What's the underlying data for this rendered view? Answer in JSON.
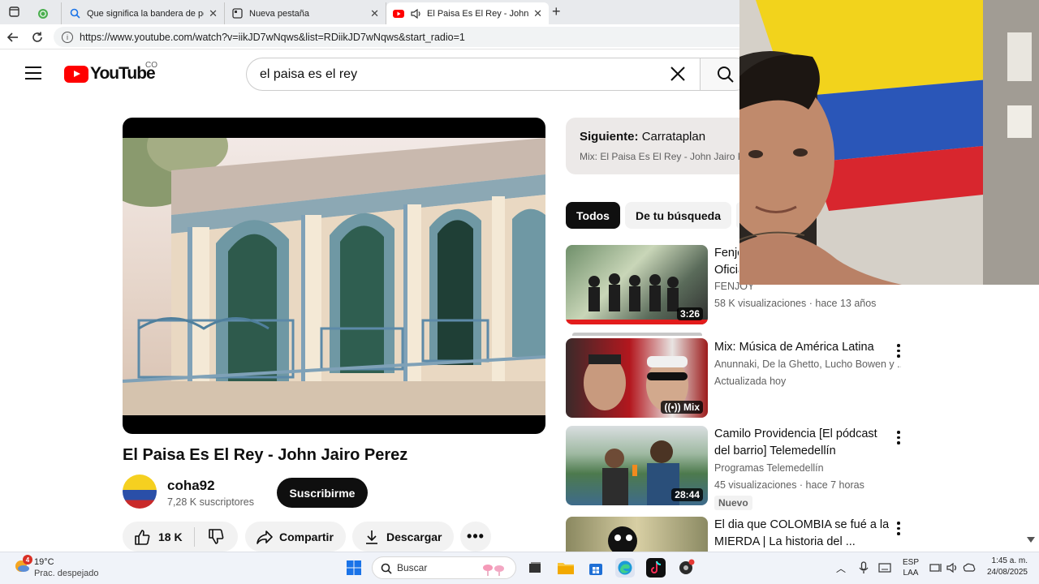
{
  "browser": {
    "tabs": [
      {
        "title": ""
      },
      {
        "title": "Que significa la bandera de pereira"
      },
      {
        "title": "Nueva pestaña"
      },
      {
        "title": "El Paisa Es El Rey - John Jairo Perez"
      }
    ],
    "url": "https://www.youtube.com/watch?v=iikJD7wNqws&list=RDiikJD7wNqws&start_radio=1"
  },
  "youtube": {
    "logo_text": "YouTube",
    "country_code": "CO",
    "search_query": "el paisa es el rey"
  },
  "video": {
    "title": "El Paisa Es El Rey - John Jairo Perez",
    "channel": "coha92",
    "subscribers": "7,28 K suscriptores",
    "subscribe_label": "Suscribirme",
    "likes": "18 K",
    "share_label": "Compartir",
    "download_label": "Descargar"
  },
  "up_next": {
    "prefix": "Siguiente:",
    "title": "Carrataplan",
    "playlist": "Mix: El Paisa Es El Rey - John Jairo Perez"
  },
  "chips": [
    "Todos",
    "De tu búsqueda"
  ],
  "recommendations": [
    {
      "title1": "Fenjoy - El Paisa Es El Rey (Video",
      "title2": "Oficial)",
      "channel": "FENJOY",
      "meta": "58 K visualizaciones · hace 13 años",
      "badge": "3:26"
    },
    {
      "title1": "Mix: Música de América Latina",
      "title2": "",
      "channel": "Anunnaki, De la Ghetto, Lucho Bowen y ...",
      "meta": "Actualizada hoy",
      "badge": "Mix"
    },
    {
      "title1": "Camilo Providencia [El pódcast",
      "title2": "del barrio] Telemedellín",
      "channel": "Programas Telemedellín",
      "meta": "45 visualizaciones · hace 7 horas",
      "badge": "28:44",
      "tag": "Nuevo"
    },
    {
      "title1": "El dia que COLOMBIA se fué a la",
      "title2": "MIERDA | La historia del ...",
      "channel": "",
      "meta": "",
      "badge": ""
    }
  ],
  "taskbar": {
    "weather_temp": "19°C",
    "weather_desc": "Prac. despejado",
    "weather_badge": "4",
    "search_placeholder": "Buscar",
    "lang1": "ESP",
    "lang2": "LAA",
    "time": "1:45 a. m.",
    "date": "24/08/2025"
  },
  "colors": {
    "yt_red": "#ff0000",
    "chip_active": "#0f0f0f",
    "upnext_bg": "#ece9e8"
  }
}
